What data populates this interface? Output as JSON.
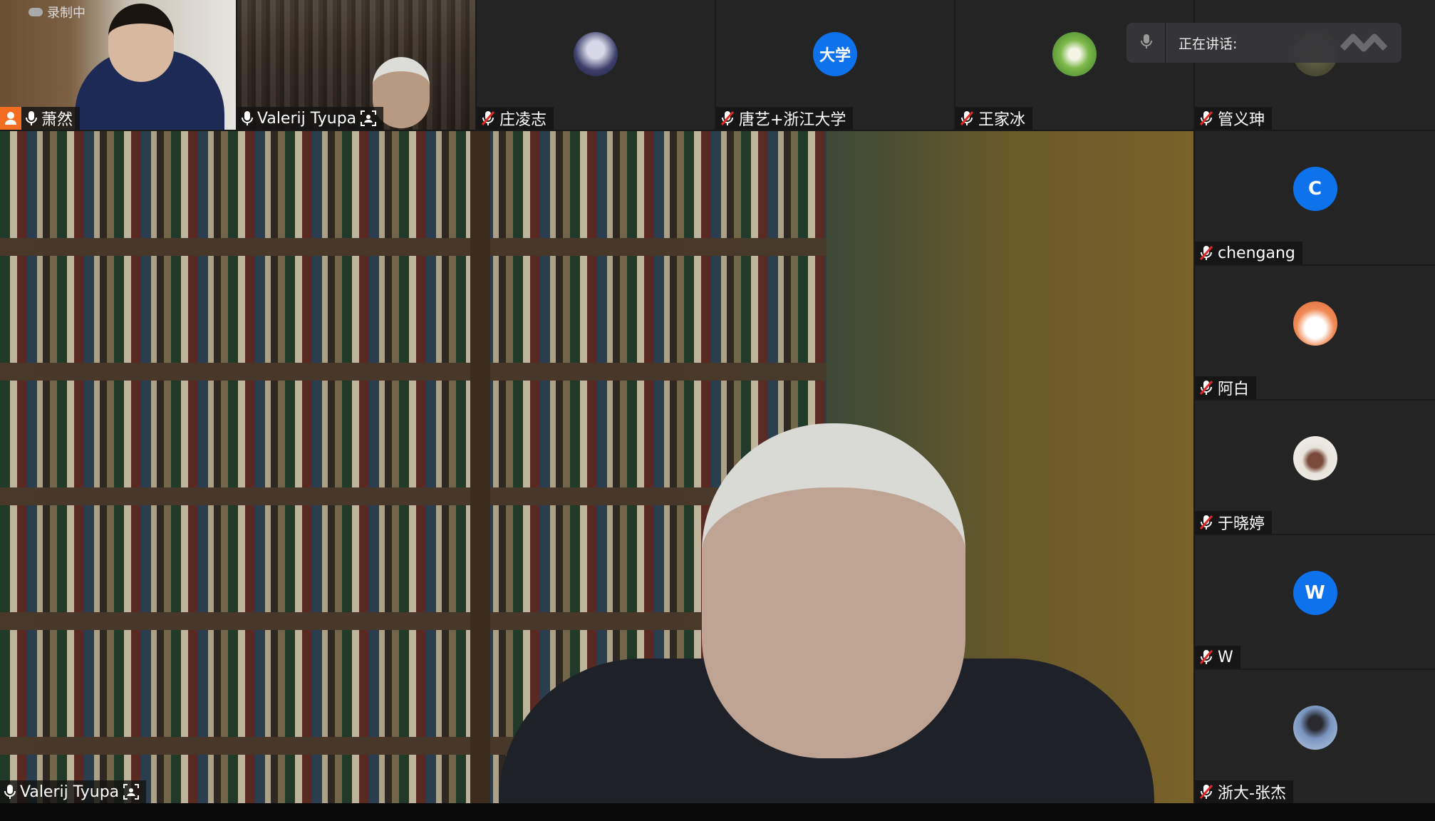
{
  "recording": {
    "label": "录制中"
  },
  "speaking": {
    "label": "正在讲话:"
  },
  "top_row": [
    {
      "name": "萧然",
      "mic": "on"
    },
    {
      "name": "Valerij Tyupa",
      "mic": "on"
    },
    {
      "name": "庄凌志",
      "mic": "muted"
    },
    {
      "name": "唐艺+浙江大学",
      "mic": "muted",
      "avatar_text": "大学"
    },
    {
      "name": "王家冰",
      "mic": "muted"
    },
    {
      "name": "管义珅",
      "mic": "muted"
    }
  ],
  "side_column": [
    {
      "name": "chengang",
      "mic": "muted",
      "avatar_letter": "C"
    },
    {
      "name": "阿白",
      "mic": "muted"
    },
    {
      "name": "于晓婷",
      "mic": "muted"
    },
    {
      "name": "W",
      "mic": "muted",
      "avatar_letter": "W"
    },
    {
      "name": "浙大-张杰",
      "mic": "muted"
    }
  ],
  "main_video": {
    "name": "Valerij Tyupa",
    "mic": "on"
  },
  "colors": {
    "accent": "#0e72ed",
    "muted_mic": "#e02828",
    "recording_orange": "#f26d21"
  }
}
